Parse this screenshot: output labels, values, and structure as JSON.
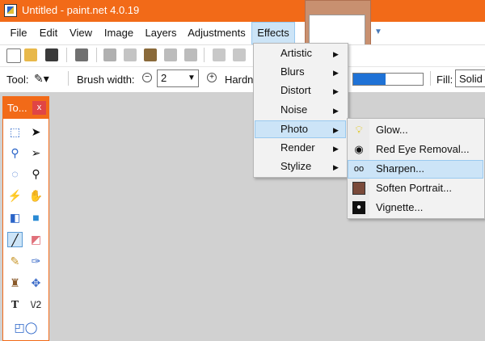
{
  "window": {
    "title": "Untitled - paint.net 4.0.19"
  },
  "menubar": {
    "items": [
      {
        "label": "File"
      },
      {
        "label": "Edit"
      },
      {
        "label": "View"
      },
      {
        "label": "Image"
      },
      {
        "label": "Layers"
      },
      {
        "label": "Adjustments"
      },
      {
        "label": "Effects"
      }
    ]
  },
  "options": {
    "tool_label": "Tool:",
    "brush_width_label": "Brush width:",
    "brush_width_value": "2",
    "hardness_label": "Hardn",
    "fill_label": "Fill:",
    "fill_value": "Solid",
    "hardness_fraction": 0.47
  },
  "tools_panel": {
    "title": "To...",
    "close": "x"
  },
  "effects_menu": {
    "items": [
      {
        "label": "Artistic"
      },
      {
        "label": "Blurs"
      },
      {
        "label": "Distort"
      },
      {
        "label": "Noise"
      },
      {
        "label": "Photo"
      },
      {
        "label": "Render"
      },
      {
        "label": "Stylize"
      }
    ],
    "highlighted": "Photo"
  },
  "photo_submenu": {
    "items": [
      {
        "label": "Glow...",
        "icon": "bulb-icon"
      },
      {
        "label": "Red Eye Removal...",
        "icon": "eye-icon"
      },
      {
        "label": "Sharpen...",
        "icon": "glasses-icon"
      },
      {
        "label": "Soften Portrait...",
        "icon": "portrait-icon"
      },
      {
        "label": "Vignette...",
        "icon": "vignette-icon"
      }
    ],
    "highlighted": "Sharpen..."
  },
  "colors": {
    "accent": "#f26a18",
    "highlight": "#cce4f7",
    "canvas": "#d1d1d1",
    "progress": "#1f72d6"
  }
}
